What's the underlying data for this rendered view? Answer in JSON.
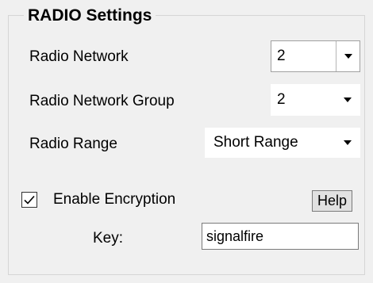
{
  "group": {
    "title": "RADIO Settings"
  },
  "radio_network": {
    "label": "Radio Network",
    "value": "2"
  },
  "radio_network_group": {
    "label": "Radio Network Group",
    "value": "2"
  },
  "radio_range": {
    "label": "Radio Range",
    "value": "Short Range"
  },
  "encryption": {
    "label": "Enable Encryption",
    "checked": true,
    "help_label": "Help"
  },
  "key": {
    "label": "Key:",
    "value": "signalfire"
  },
  "icons": {
    "dropdown": "chevron-down-icon",
    "check": "check-icon"
  }
}
